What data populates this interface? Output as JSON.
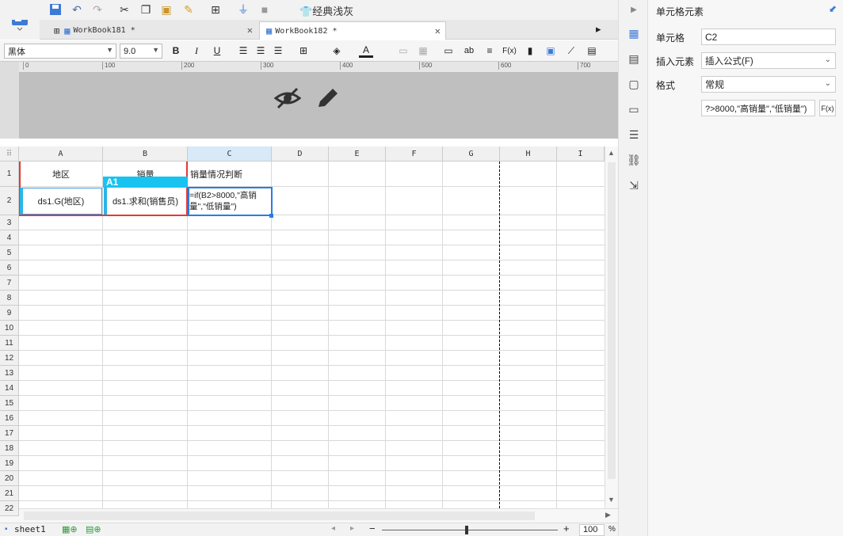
{
  "toolbar": {
    "theme_label": "经典浅灰"
  },
  "tabs": [
    {
      "label": "WorkBook181 *"
    },
    {
      "label": "WorkBook182 *"
    }
  ],
  "format": {
    "font_family": "黑体",
    "font_size": "9.0",
    "bold": "B",
    "italic": "I",
    "underline": "U"
  },
  "ruler": [
    "0",
    "100",
    "200",
    "300",
    "400",
    "500",
    "600",
    "700"
  ],
  "columns": [
    "A",
    "B",
    "C",
    "D",
    "E",
    "F",
    "G",
    "H",
    "I"
  ],
  "rows": [
    "1",
    "2",
    "3",
    "4",
    "5",
    "6",
    "7",
    "8",
    "9",
    "10",
    "11",
    "12",
    "13",
    "14",
    "15",
    "16",
    "17",
    "18",
    "19",
    "20",
    "21",
    "22"
  ],
  "cells": {
    "A1": "地区",
    "B1": "销量",
    "C1": "销量情况判断",
    "A2": "ds1.G(地区)",
    "B2": "ds1.求和(销售员)",
    "C2_line1": "=if(B2>8000,\"高销",
    "C2_line2": "量\",\"低销量\")"
  },
  "badge": "A1",
  "sheet": {
    "name": "sheet1"
  },
  "zoom": "100",
  "zoom_unit": "%",
  "panel": {
    "title": "单元格元素",
    "cell_label": "单元格",
    "cell_value": "C2",
    "insert_label": "插入元素",
    "insert_value": "插入公式(F)",
    "format_label": "格式",
    "format_value": "常规",
    "formula_value": "?>8000,\"高销量\",\"低销量\")",
    "fx": "F(x)"
  }
}
